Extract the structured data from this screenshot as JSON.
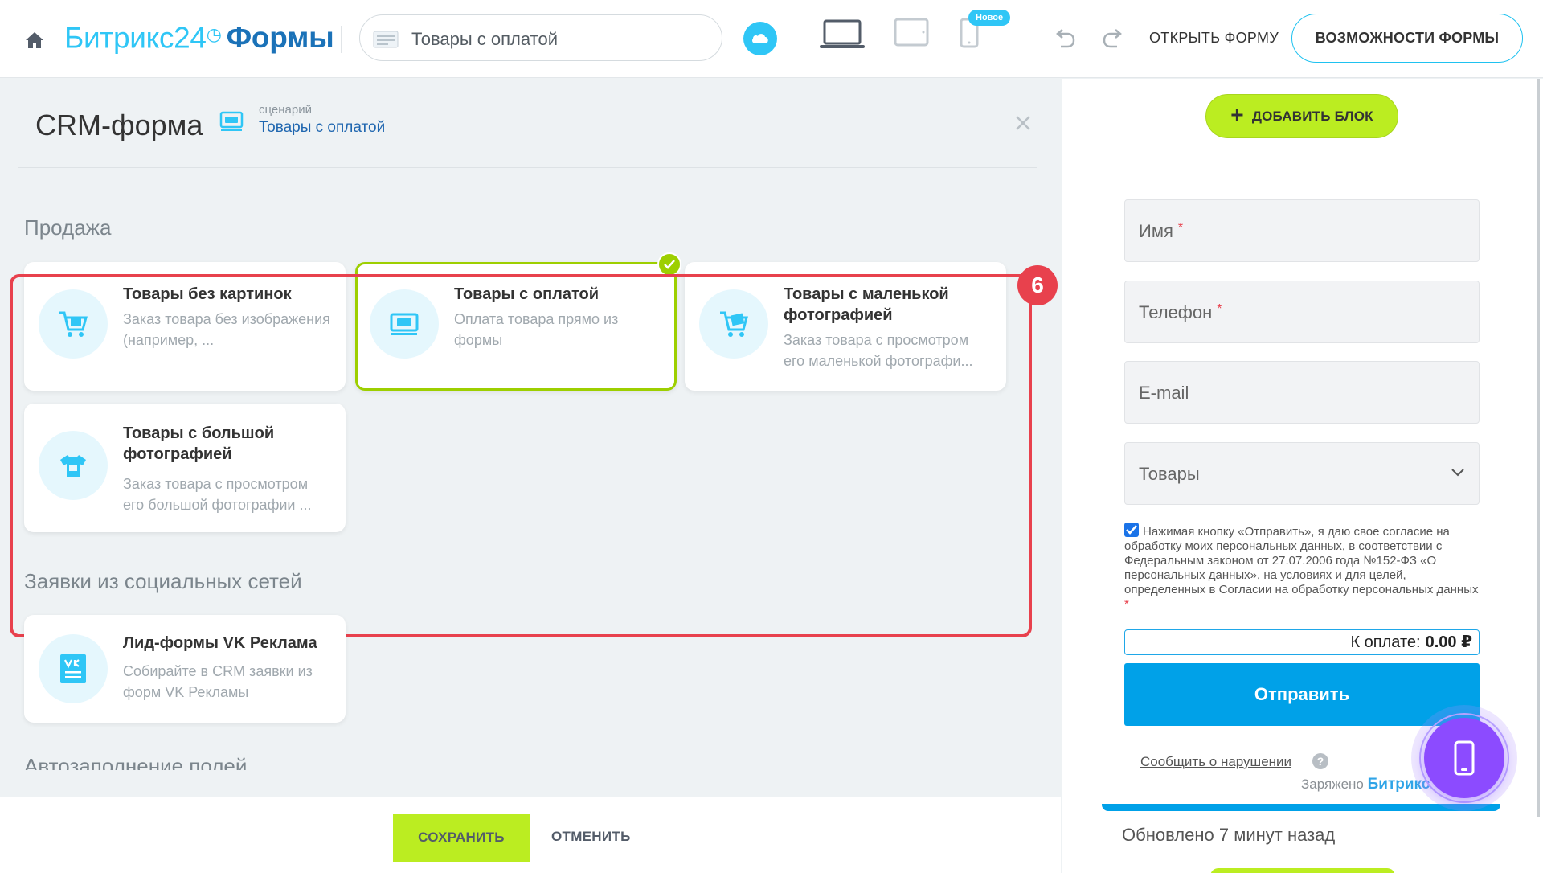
{
  "header": {
    "logo_main": "Битрикс24",
    "logo_clock": "◷",
    "logo_product": "Формы",
    "form_title": "Товары с оплатой",
    "new_badge": "Новое",
    "open_form": "ОТКРЫТЬ ФОРМУ",
    "features": "ВОЗМОЖНОСТИ ФОРМЫ"
  },
  "panel": {
    "title": "CRM-форма",
    "scenario_label": "сценарий",
    "scenario_value": "Товары с оплатой"
  },
  "sections": [
    {
      "title": "Продажа",
      "cards": [
        {
          "title": "Товары без картинок",
          "desc": "Заказ товара без изображения (например, ...",
          "icon": "cart-icon",
          "selected": false
        },
        {
          "title": "Товары с оплатой",
          "desc": "Оплата товара прямо из формы",
          "icon": "payment-icon",
          "selected": true
        },
        {
          "title": "Товары с маленькой фотографией",
          "desc": "Заказ товара с просмотром его маленькой фотографи...",
          "icon": "cart-image-icon",
          "selected": false
        },
        {
          "title": "Товары с большой фотографией",
          "desc": "Заказ товара с просмотром его большой фотографии ...",
          "icon": "tshirt-icon",
          "selected": false
        }
      ]
    },
    {
      "title": "Заявки из социальных сетей",
      "cards": [
        {
          "title": "Лид-формы VK Реклама",
          "desc": "Собирайте в CRM заявки из форм VK Рекламы",
          "icon": "vk-form-icon",
          "selected": false
        }
      ]
    },
    {
      "title": "Автозаполнение полей"
    }
  ],
  "step_badge": "6",
  "footer": {
    "save": "СОХРАНИТЬ",
    "cancel": "ОТМЕНИТЬ"
  },
  "preview": {
    "add_block": "ДОБАВИТЬ БЛОК",
    "fields": [
      {
        "label": "Имя",
        "required": "*"
      },
      {
        "label": "Телефон",
        "required": "*"
      },
      {
        "label": "E-mail",
        "required": ""
      },
      {
        "label": "Товары",
        "required": ""
      }
    ],
    "consent": "Нажимая кнопку «Отправить», я даю свое согласие на обработку моих персональных данных, в соответствии с Федеральным законом от 27.07.2006 года №152-ФЗ «О персональных данных», на условиях и для целей, определенных в Согласии на обработку персональных данных",
    "consent_required": "*",
    "total_label": "К оплате:",
    "total_value": "0.00 ₽",
    "submit": "Отправить",
    "report": "Сообщить о нарушении",
    "help": "?",
    "powered_prefix": "Заряжено",
    "powered_brand": "Битрикс",
    "updated": "Обновлено 7 минут назад"
  },
  "colors": {
    "accent_blue": "#2fc6f6",
    "brand_blue": "#1b72b8",
    "green": "#bbed21",
    "selected_border": "#9dcf00",
    "highlight_red": "#e8414d",
    "submit_blue": "#00a1e8",
    "fab_purple": "#8c4bff"
  }
}
